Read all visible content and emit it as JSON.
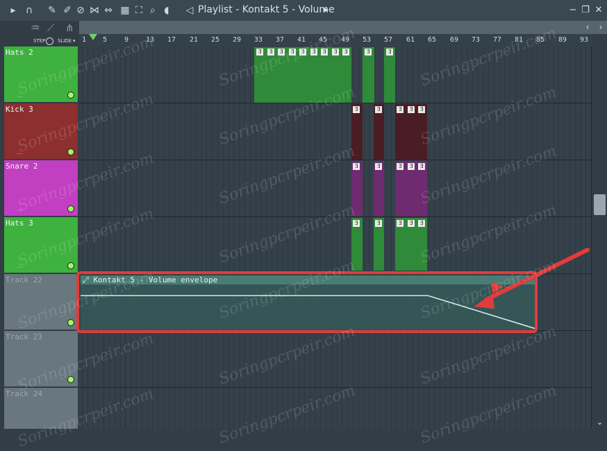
{
  "window": {
    "title": "Playlist - Kontakt 5 - Volume",
    "title_arrow": "▸",
    "controls": {
      "minimize": "−",
      "restore": "❐",
      "close": "✕"
    }
  },
  "header": {
    "step_label": "STEP",
    "slide_label": "SLIDE",
    "slide_arrow": "▾"
  },
  "ruler": [
    "1",
    "5",
    "9",
    "13",
    "17",
    "21",
    "25",
    "29",
    "33",
    "37",
    "41",
    "45",
    "49",
    "53",
    "57",
    "61",
    "65",
    "69",
    "73",
    "77",
    "81",
    "85",
    "89",
    "93"
  ],
  "tracks": [
    {
      "name": "Hats 2",
      "dots": "...",
      "color": "#3fb13f"
    },
    {
      "name": "Kick 3",
      "dots": "...",
      "color": "#8d2f2f"
    },
    {
      "name": "Snare 2",
      "dots": "...",
      "color": "#c13fc1"
    },
    {
      "name": "Hats 3",
      "dots": "...",
      "color": "#3fb13f"
    },
    {
      "name": "Track 22",
      "dots": "...",
      "color": "#69777e"
    },
    {
      "name": "Track 23",
      "dots": "...",
      "color": "#69777e"
    },
    {
      "name": "Track 24",
      "dots": "...",
      "color": "#69777e"
    }
  ],
  "envelope": {
    "name": "Kontakt 5 - Volume envelope"
  },
  "watermark": "Soringpcrpeir.com",
  "colors": {
    "accent_red": "#e23b3b",
    "green": "#3fb13f",
    "red": "#8d2f2f",
    "purple": "#c13fc1"
  }
}
